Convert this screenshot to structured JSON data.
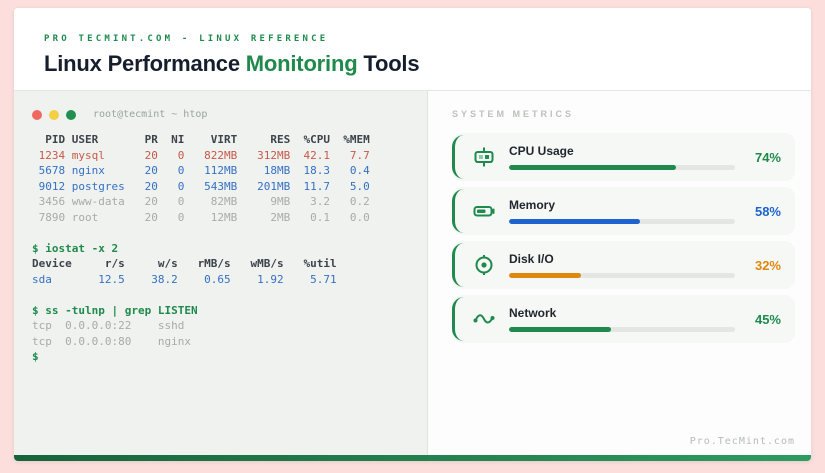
{
  "page": {
    "background": "#fcdfdc",
    "accent_green": "#1f8a4c"
  },
  "header": {
    "eyebrow": "PRO TECMINT.COM  -  LINUX REFERENCE",
    "title_prefix": "Linux Performance ",
    "title_highlight": "Monitoring",
    "title_suffix": " Tools"
  },
  "terminal": {
    "window_title": "root@tecmint ~ htop",
    "traffic_lights": [
      "#ee6a60",
      "#f2cf45",
      "#23904f"
    ],
    "lines": [
      {
        "style": "thead",
        "text": "  PID USER       PR  NI    VIRT     RES  %CPU  %MEM"
      },
      {
        "style": "red",
        "text": " 1234 mysql      20   0   822MB   312MB  42.1   7.7"
      },
      {
        "style": "blue",
        "text": " 5678 nginx      20   0   112MB    18MB  18.3   0.4"
      },
      {
        "style": "blue",
        "text": " 9012 postgres   20   0   543MB   201MB  11.7   5.0"
      },
      {
        "style": "dim",
        "text": " 3456 www-data   20   0    82MB     9MB   3.2   0.2"
      },
      {
        "style": "dim",
        "text": " 7890 root       20   0    12MB     2MB   0.1   0.0"
      },
      {
        "style": "blank",
        "text": ""
      },
      {
        "style": "cmd",
        "text": "$ iostat -x 2"
      },
      {
        "style": "thead",
        "text": "Device     r/s     w/s   rMB/s   wMB/s   %util"
      },
      {
        "style": "blue",
        "text": "sda       12.5    38.2    0.65    1.92    5.71"
      },
      {
        "style": "blank",
        "text": ""
      },
      {
        "style": "cmd",
        "text": "$ ss -tulnp | grep LISTEN"
      },
      {
        "style": "dim",
        "text": "tcp  0.0.0.0:22    sshd"
      },
      {
        "style": "dim",
        "text": "tcp  0.0.0.0:80    nginx"
      },
      {
        "style": "cmd",
        "text": "$"
      }
    ]
  },
  "metrics": {
    "section_label": "SYSTEM METRICS",
    "items": [
      {
        "label": "CPU Usage",
        "value": 74,
        "display": "74%",
        "color": "#1f8a4c",
        "icon": "cpu-icon"
      },
      {
        "label": "Memory",
        "value": 58,
        "display": "58%",
        "color": "#1e63cf",
        "icon": "memory-icon"
      },
      {
        "label": "Disk I/O",
        "value": 32,
        "display": "32%",
        "color": "#e1870f",
        "icon": "disk-icon"
      },
      {
        "label": "Network",
        "value": 45,
        "display": "45%",
        "color": "#1f8a4c",
        "icon": "network-icon"
      }
    ]
  },
  "footer": {
    "watermark": "Pro.TecMint.com"
  }
}
